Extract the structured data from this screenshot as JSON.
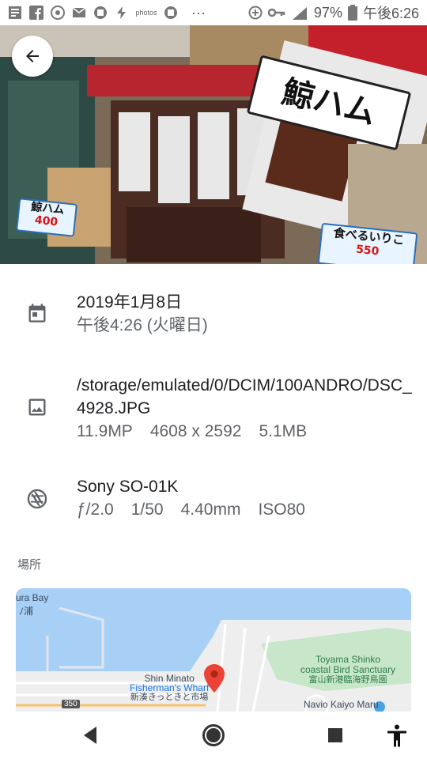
{
  "status_bar": {
    "icons": [
      "news-icon",
      "facebook-icon",
      "chrome-icon",
      "mail-icon",
      "cup-icon",
      "flash-icon",
      "photos-icon",
      "cup-icon",
      "more-icon",
      "add-circle-icon",
      "key-icon",
      "signal-4g-icon",
      "battery-icon"
    ],
    "photos_label": "photos",
    "more_label": "···",
    "battery_percent": "97%",
    "time": "午後6:26"
  },
  "photo": {
    "sign_main_text": "鯨ハム",
    "sign_left_text": "鯨ハム",
    "sign_left_price": "400",
    "sign_right_text": "食べるいりこ",
    "sign_right_price": "550"
  },
  "details": {
    "date": "2019年1月8日",
    "time": "午後4:26 (火曜日)",
    "path": "/storage/emulated/0/DCIM/100ANDRO/DSC_4928.JPG",
    "megapixels": "11.9MP",
    "resolution": "4608 x 2592",
    "filesize": "5.1MB",
    "device": "Sony SO-01K",
    "aperture": "ƒ/2.0",
    "shutter": "1/50",
    "focal_length": "4.40mm",
    "iso": "ISO80"
  },
  "location_label": "場所",
  "map": {
    "bay_label": "ura Bay",
    "bay_label_jp": "ﾉ浦",
    "sanctuary_en_1": "Toyama Shinko",
    "sanctuary_en_2": "coastal Bird Sanctuary",
    "sanctuary_jp": "富山新港臨海野鳥園",
    "wharf_en_1": "Shin Minato",
    "wharf_en_2": "Fisherman's Wharf",
    "wharf_jp": "新湊きっときと市場",
    "ship_label": "Navio Kaiyo Maru",
    "route_number": "350",
    "colors": {
      "water": "#a8d0f7",
      "park": "#c8e6c9",
      "land": "#eeeeee",
      "pin": "#ea4335"
    }
  }
}
